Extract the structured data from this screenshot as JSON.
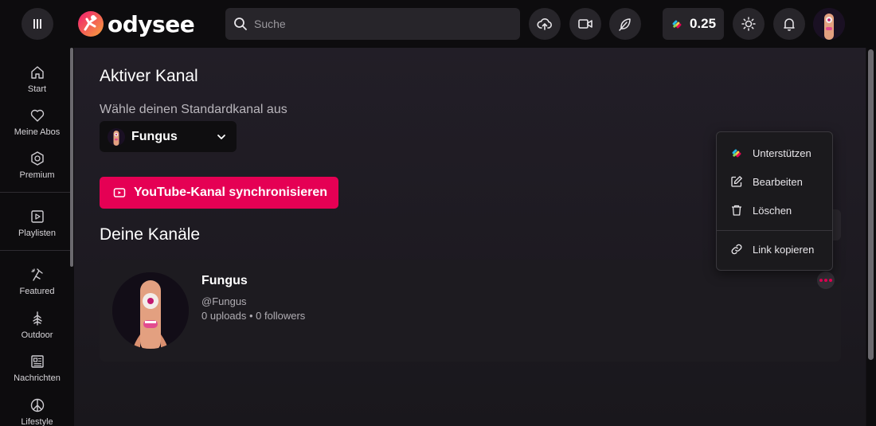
{
  "header": {
    "logo_text": "odysee",
    "search_placeholder": "Suche",
    "credits": "0.25"
  },
  "sidebar": {
    "items": [
      {
        "label": "Start",
        "icon": "home-icon"
      },
      {
        "label": "Meine Abos",
        "icon": "heart-icon"
      },
      {
        "label": "Premium",
        "icon": "premium-icon"
      },
      {
        "label": "Playlisten",
        "icon": "playlist-icon"
      },
      {
        "label": "Featured",
        "icon": "featured-icon"
      },
      {
        "label": "Outdoor",
        "icon": "tree-icon"
      },
      {
        "label": "Nachrichten",
        "icon": "newspaper-icon"
      },
      {
        "label": "Lifestyle",
        "icon": "peace-icon"
      }
    ]
  },
  "main": {
    "active_channel_title": "Aktiver Kanal",
    "default_channel_label": "Wähle deinen Standardkanal aus",
    "selected_channel": "Fungus",
    "youtube_sync_label": "YouTube-Kanal synchronisieren",
    "your_channels_title": "Deine Kanäle",
    "channel_card": {
      "title": "Fungus",
      "handle": "@Fungus",
      "stats": "0 uploads • 0 followers"
    }
  },
  "context_menu": {
    "items": [
      {
        "label": "Unterstützen",
        "icon": "support-icon"
      },
      {
        "label": "Bearbeiten",
        "icon": "edit-icon"
      },
      {
        "label": "Löschen",
        "icon": "trash-icon"
      },
      {
        "label": "Link kopieren",
        "icon": "link-icon"
      }
    ]
  },
  "colors": {
    "accent": "#e50054",
    "background": "#141216",
    "header": "#0d0c0e"
  }
}
